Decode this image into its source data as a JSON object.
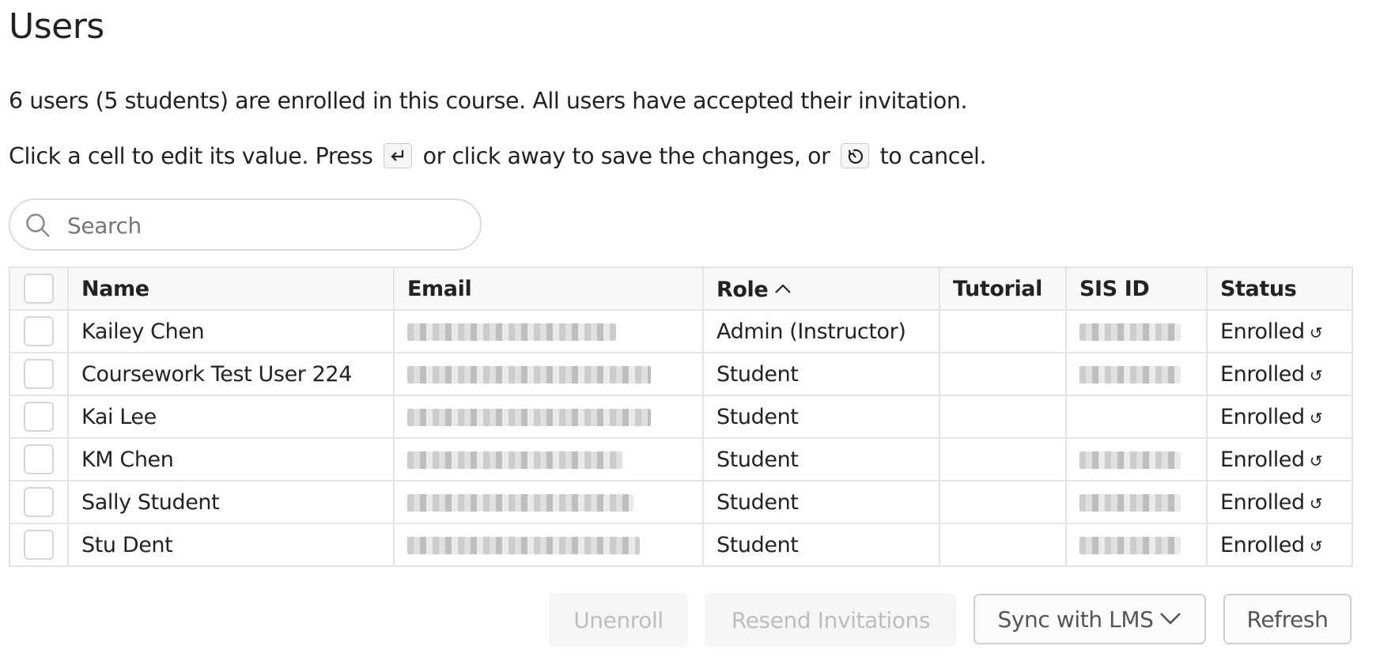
{
  "page": {
    "title": "Users",
    "summary": "6 users (5 students) are enrolled in this course. All users have accepted their invitation.",
    "instructions": {
      "part1": "Click a cell to edit its value. Press",
      "enter_key_icon": "enter-key-icon",
      "part2": "or click away to save the changes, or",
      "escape_key_icon": "undo-key-icon",
      "part3": "to cancel."
    }
  },
  "search": {
    "placeholder": "Search",
    "value": "",
    "icon": "search-icon"
  },
  "table": {
    "columns": [
      {
        "label": "",
        "type": "select-all-checkbox"
      },
      {
        "label": "Name"
      },
      {
        "label": "Email"
      },
      {
        "label": "Role",
        "sort": "ascending"
      },
      {
        "label": "Tutorial"
      },
      {
        "label": "SIS ID"
      },
      {
        "label": "Status"
      }
    ],
    "rows": [
      {
        "name": "Kailey Chen",
        "email": "[redacted]",
        "role": "Admin (Instructor)",
        "tutorial": "",
        "sis_id": "[redacted]",
        "status": "Enrolled"
      },
      {
        "name": "Coursework Test User 224",
        "email": "[redacted]",
        "role": "Student",
        "tutorial": "",
        "sis_id": "[redacted]",
        "status": "Enrolled"
      },
      {
        "name": "Kai Lee",
        "email": "[redacted]",
        "role": "Student",
        "tutorial": "",
        "sis_id": "",
        "status": "Enrolled"
      },
      {
        "name": "KM Chen",
        "email": "[redacted]",
        "role": "Student",
        "tutorial": "",
        "sis_id": "[redacted]",
        "status": "Enrolled"
      },
      {
        "name": "Sally Student",
        "email": "[redacted]",
        "role": "Student",
        "tutorial": "",
        "sis_id": "[redacted]",
        "status": "Enrolled"
      },
      {
        "name": "Stu Dent",
        "email": "[redacted]",
        "role": "Student",
        "tutorial": "",
        "sis_id": "[redacted]",
        "status": "Enrolled"
      }
    ],
    "status_action_glyph": "↺"
  },
  "actions": {
    "unenroll_label": "Unenroll",
    "resend_label": "Resend Invitations",
    "sync_label": "Sync with LMS",
    "refresh_label": "Refresh"
  },
  "colors": {
    "text": "#222222",
    "border": "#e4e4e4",
    "header_bg": "#f8f8f8",
    "disabled_text": "#bdbdbd",
    "disabled_bg": "#f6f6f6"
  }
}
